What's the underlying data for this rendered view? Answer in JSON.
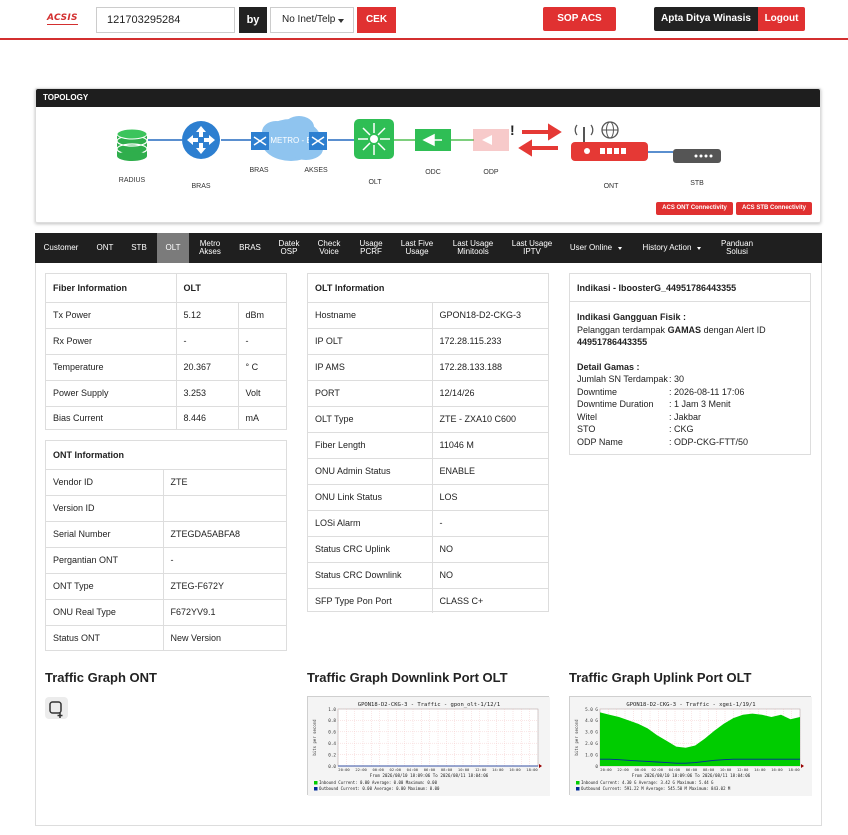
{
  "header": {
    "logo": "ACSIS",
    "search_value": "121703295284",
    "by_label": "by",
    "search_type": "No Inet/Telp",
    "cek_label": "CEK",
    "sop_label": "SOP ACS",
    "user_name": "Apta Ditya Winasis",
    "logout_label": "Logout"
  },
  "topology": {
    "title": "TOPOLOGY",
    "cloud_label": "METRO - E",
    "nodes": [
      "RADIUS",
      "BRAS",
      "BRAS",
      "AKSES",
      "OLT",
      "ODC",
      "ODP",
      "ONT",
      "STB"
    ],
    "alert_mark": "!",
    "ont_button": "ACS ONT Connectivity",
    "stb_button": "ACS STB Connectivity"
  },
  "tabs": [
    {
      "label": "Customer"
    },
    {
      "label": "ONT"
    },
    {
      "label": "STB"
    },
    {
      "label": "OLT"
    },
    {
      "label1": "Metro",
      "label2": "Akses"
    },
    {
      "label": "BRAS"
    },
    {
      "label1": "Datek",
      "label2": "OSP"
    },
    {
      "label1": "Check",
      "label2": "Voice"
    },
    {
      "label1": "Usage",
      "label2": "PCRF"
    },
    {
      "label1": "Last Five",
      "label2": "Usage"
    },
    {
      "label1": "Last Usage",
      "label2": "Minitools"
    },
    {
      "label1": "Last Usage",
      "label2": "IPTV"
    },
    {
      "label": "User Online"
    },
    {
      "label": "History Action"
    },
    {
      "label1": "Panduan",
      "label2": "Solusi"
    }
  ],
  "fiber": {
    "headers": [
      "Fiber Information",
      "OLT"
    ],
    "rows": [
      {
        "name": "Tx Power",
        "value": "5.12",
        "unit": "dBm"
      },
      {
        "name": "Rx Power",
        "value": "-",
        "unit": "-"
      },
      {
        "name": "Temperature",
        "value": "20.367",
        "unit": "° C"
      },
      {
        "name": "Power Supply",
        "value": "3.253",
        "unit": "Volt"
      },
      {
        "name": "Bias Current",
        "value": "8.446",
        "unit": "mA"
      }
    ]
  },
  "ont_info": {
    "header": "ONT Information",
    "rows": [
      {
        "name": "Vendor ID",
        "value": "ZTE"
      },
      {
        "name": "Version ID",
        "value": ""
      },
      {
        "name": "Serial Number",
        "value": "ZTEGDA5ABFA8"
      },
      {
        "name": "Pergantian ONT",
        "value": "-"
      },
      {
        "name": "ONT Type",
        "value": "ZTEG-F672Y"
      },
      {
        "name": "ONU Real Type",
        "value": "F672YV9.1"
      },
      {
        "name": "Status ONT",
        "value": "New Version"
      }
    ]
  },
  "olt_info": {
    "header": "OLT Information",
    "rows": [
      {
        "name": "Hostname",
        "value": "GPON18-D2-CKG-3"
      },
      {
        "name": "IP OLT",
        "value": "172.28.115.233"
      },
      {
        "name": "IP AMS",
        "value": "172.28.133.188"
      },
      {
        "name": "PORT",
        "value": "12/14/26"
      },
      {
        "name": "OLT Type",
        "value": "ZTE - ZXA10 C600"
      },
      {
        "name": "Fiber Length",
        "value": "11046 M"
      },
      {
        "name": "ONU Admin Status",
        "value": "ENABLE"
      },
      {
        "name": "ONU Link Status",
        "value": "LOS"
      },
      {
        "name": "LOSi Alarm",
        "value": "-"
      },
      {
        "name": "Status CRC Uplink",
        "value": "NO"
      },
      {
        "name": "Status CRC Downlink",
        "value": "NO"
      },
      {
        "name": "SFP Type Pon Port",
        "value": "CLASS C+"
      }
    ]
  },
  "indikasi": {
    "title": "Indikasi - IboosterG_44951786443355",
    "gangguan_title": "Indikasi Gangguan Fisik :",
    "gangguan_text_a": "Pelanggan terdampak ",
    "gangguan_text_b": "GAMAS",
    "gangguan_text_c": " dengan Alert ID",
    "alert_id": "44951786443355",
    "detail_title": "Detail Gamas :",
    "details": [
      {
        "k": "Jumlah SN Terdampak",
        "v": ": 30"
      },
      {
        "k": "Downtime",
        "v": ": 2026-08-11 17:06"
      },
      {
        "k": "Downtime Duration",
        "v": ": 1 Jam 3 Menit"
      },
      {
        "k": "Witel",
        "v": ": Jakbar"
      },
      {
        "k": "STO",
        "v": ": CKG"
      },
      {
        "k": "ODP Name",
        "v": ": ODP-CKG-FTT/50"
      }
    ]
  },
  "graphs": {
    "ont_title": "Traffic Graph ONT",
    "downlink_title": "Traffic Graph Downlink Port OLT",
    "uplink_title": "Traffic Graph Uplink Port OLT",
    "downlink_chart_title": "GPON18-D2-CKG-3 - Traffic - gpon_olt-1/12/1",
    "uplink_chart_title": "GPON18-D2-CKG-3 - Traffic - xgei-1/19/1",
    "y_axis_label": "bits per second",
    "downlink_yticks": [
      "1.0",
      "0.8",
      "0.6",
      "0.4",
      "0.2",
      "0.0"
    ],
    "uplink_yticks": [
      "5.0 G",
      "4.0 G",
      "3.0 G",
      "2.0 G",
      "1.0 G",
      "0"
    ],
    "xticks": [
      "20:00",
      "22:00",
      "00:00",
      "02:00",
      "04:00",
      "06:00",
      "08:00",
      "10:00",
      "12:00",
      "14:00",
      "16:00",
      "18:00"
    ],
    "range": "From 2026/08/10 18:09:06 To 2026/08/11 18:04:06",
    "dl_inbound": "Inbound    Current:    0.00    Average:    0.00    Maximum:    0.00",
    "dl_outbound": "Outbound   Current:    0.00    Average:    0.00    Maximum:    0.00",
    "ul_inbound": "Inbound    Current:    4.30 G   Average:    3.42 G   Maximum:    5.44 G",
    "ul_outbound": "Outbound   Current:  591.22 M   Average:  545.50 M   Maximum:  843.02 M",
    "inbound_color": "#00cc00",
    "outbound_color": "#002a97",
    "uplink_inbound_series": [
      4.7,
      4.5,
      4.3,
      4.0,
      3.7,
      3.3,
      2.7,
      2.2,
      1.7,
      1.6,
      1.8,
      2.4,
      3.1,
      3.7,
      4.2,
      4.5,
      4.6,
      4.5,
      4.3,
      4.5,
      4.1,
      4.3
    ],
    "uplink_outbound_series": [
      0.6,
      0.6,
      0.55,
      0.5,
      0.45,
      0.4,
      0.35,
      0.3,
      0.25,
      0.25,
      0.3,
      0.4,
      0.5,
      0.55,
      0.6,
      0.6,
      0.6,
      0.6,
      0.6,
      0.6,
      0.6,
      0.6
    ]
  }
}
